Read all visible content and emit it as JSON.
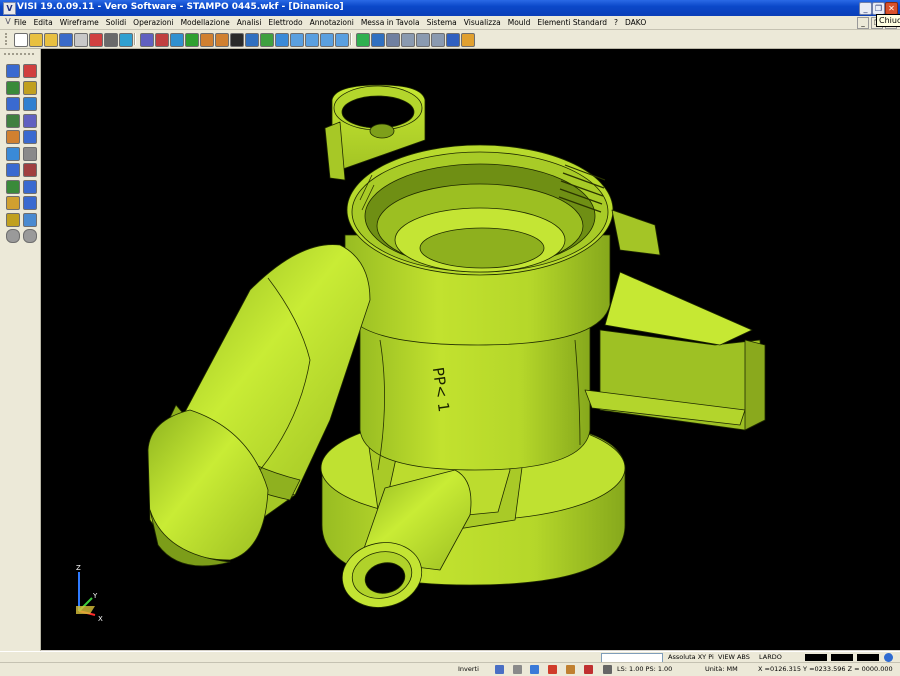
{
  "window": {
    "app_icon": "V",
    "title": "VISI 19.0.09.11 - Vero Software - STAMPO 0445.wkf - [Dinamico]",
    "close_tooltip": "Chiudi",
    "buttons": [
      "minimize-icon",
      "restore-icon",
      "close-icon"
    ]
  },
  "menubar": {
    "items": [
      "File",
      "Edita",
      "Wireframe",
      "Solidi",
      "Operazioni",
      "Modellazione",
      "Analisi",
      "Elettrodo",
      "Annotazioni",
      "Messa in Tavola",
      "Sistema",
      "Visualizza",
      "Mould",
      "Elementi Standard",
      "?",
      "DAKO"
    ]
  },
  "toolbar": {
    "icons": [
      "new-file-icon",
      "open-folder-icon",
      "open-folder-icon",
      "save-icon",
      "print-preview-icon",
      "properties-icon",
      "print-icon",
      "plot-icon",
      "layers-icon",
      "cut-icon",
      "copy-icon",
      "paste-icon",
      "undo-icon",
      "redo-icon",
      "pan-icon",
      "zoom-icon",
      "rotate-icon",
      "refresh-icon",
      "view-top-icon",
      "view-front-icon",
      "view-right-icon",
      "view-iso-icon",
      "shade-icon",
      "wire-icon",
      "hidden-icon",
      "cylinder-icon",
      "cylinder-icon",
      "cylinder-icon",
      "measure-icon",
      "grid-icon"
    ]
  },
  "left_toolbar": {
    "icons": [
      "select-icon",
      "line-icon",
      "rectangle-icon",
      "circle-icon",
      "arc-icon",
      "spline-icon",
      "trim-icon",
      "extend-icon",
      "offset-icon",
      "fillet-icon",
      "chamfer-icon",
      "mirror-icon",
      "rotate-entity-icon",
      "array-icon",
      "move-icon",
      "copy-entity-icon",
      "scale-icon",
      "delete-icon",
      "text-icon",
      "hatch-icon",
      "back-arrow-icon",
      "forward-arrow-icon"
    ]
  },
  "viewport": {
    "engraved_text": "PP< 1",
    "axis": {
      "z": "Z",
      "y": "Y",
      "x": "X"
    },
    "colors": {
      "background": "#000000",
      "part": "#b9e02b",
      "part_shadow": "#7fa21b",
      "part_highlight": "#d9f24a",
      "edge": "#1a2200"
    }
  },
  "status": {
    "input_value": "",
    "labels": [
      "Assoluta XY Pi",
      "VIEW ABS",
      "LARDO"
    ],
    "inverti": "Inverti",
    "ls_ps": "LS: 1.00 PS: 1.00",
    "units": "Unità: MM",
    "coordinates": "X =0126.315 Y =0233.596 Z = 0000.000"
  }
}
